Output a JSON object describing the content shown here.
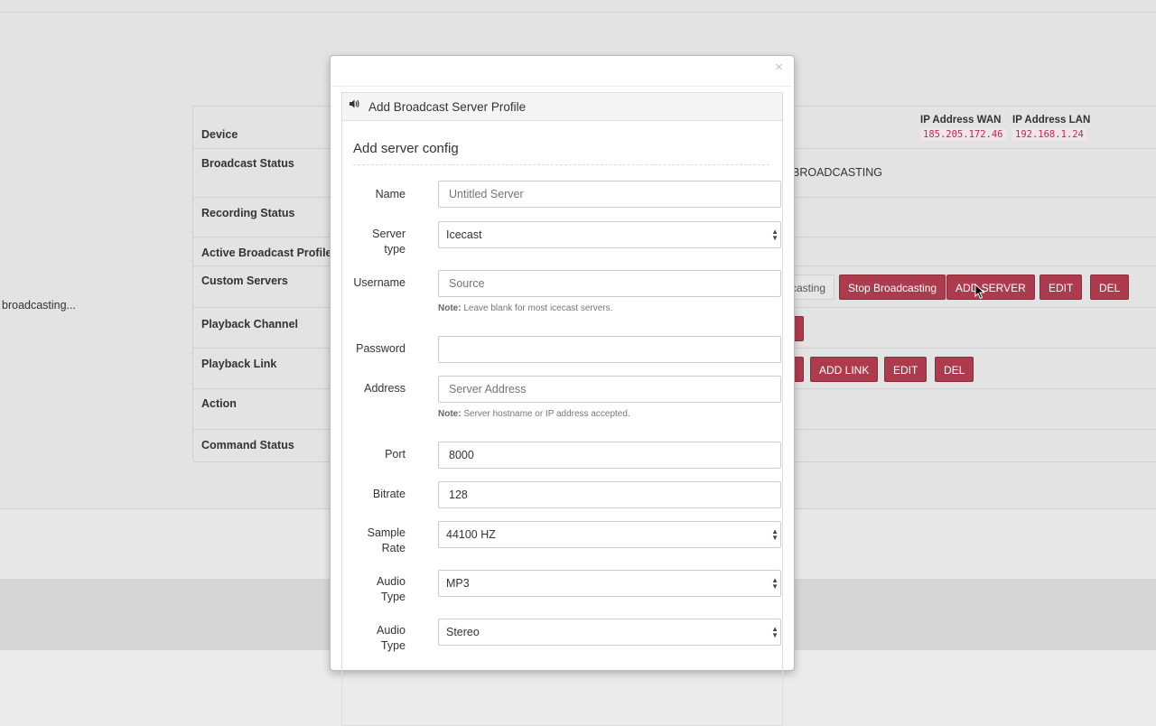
{
  "background": {
    "table_labels": [
      "Device",
      "Broadcast Status",
      "Recording Status",
      "Active Broadcast Profile",
      "Custom Servers",
      "Playback Channel",
      "Playback Link",
      "Action",
      "Command Status"
    ],
    "ip_wan_label": "IP Address WAN",
    "ip_wan_value": "185.205.172.46",
    "ip_lan_label": "IP Address LAN",
    "ip_lan_value": "192.168.1.24",
    "broadcast_status_text": "BROADCASTING",
    "left_text": "broadcasting...",
    "custom_servers": {
      "casting_label": "casting",
      "stop_label": "Stop Broadcasting",
      "add_label": "ADD SERVER",
      "edit_label": "EDIT",
      "del_label": "DEL"
    },
    "playback_link": {
      "add_label": "ADD LINK",
      "edit_label": "EDIT",
      "del_label": "DEL"
    }
  },
  "modal": {
    "close_label": "×",
    "panel_title": "Add Broadcast Server Profile",
    "section_title": "Add server config",
    "fields": {
      "name": {
        "label": "Name",
        "placeholder": "Untitled Server",
        "value": ""
      },
      "server_type": {
        "label_1": "Server",
        "label_2": "type",
        "value": "Icecast"
      },
      "username": {
        "label": "Username",
        "placeholder": "Source",
        "value": "",
        "note_bold": "Note:",
        "note": " Leave blank for most icecast servers."
      },
      "password": {
        "label": "Password",
        "value": ""
      },
      "address": {
        "label": "Address",
        "placeholder": "Server Address",
        "value": "",
        "note_bold": "Note:",
        "note": " Server hostname or IP address accepted."
      },
      "port": {
        "label": "Port",
        "value": "8000"
      },
      "bitrate": {
        "label": "Bitrate",
        "value": "128"
      },
      "sample_rate": {
        "label_1": "Sample",
        "label_2": "Rate",
        "value": "44100 HZ"
      },
      "audio_type": {
        "label_1": "Audio",
        "label_2": "Type",
        "value": "MP3"
      },
      "audio_channels": {
        "label_1": "Audio",
        "label_2": "Type",
        "value": "Stereo"
      }
    }
  }
}
